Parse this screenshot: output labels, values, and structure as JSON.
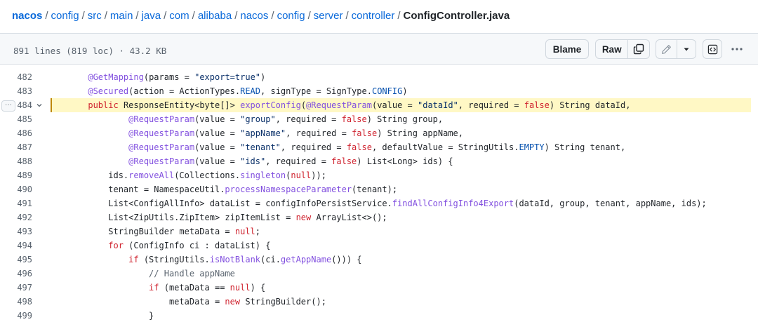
{
  "breadcrumb": {
    "parts": [
      "nacos",
      "config",
      "src",
      "main",
      "java",
      "com",
      "alibaba",
      "nacos",
      "config",
      "server",
      "controller"
    ],
    "separator": "/",
    "file": "ConfigController.java"
  },
  "toolbar": {
    "file_info": "891 lines (819 loc) · 43.2 KB",
    "blame_label": "Blame",
    "raw_label": "Raw",
    "more_label": "···"
  },
  "colors": {
    "link": "#0969da",
    "keyword": "#cf222e",
    "function": "#8250df",
    "string": "#0a3069",
    "constant": "#0550ae",
    "comment": "#59636e",
    "highlight_bg": "#fff8c5",
    "highlight_bar": "#bf8700"
  },
  "icons": {
    "copy": "copy-icon",
    "edit": "pencil-icon",
    "dropdown": "triangle-down-icon",
    "symbols": "code-square-icon",
    "more": "kebab-horizontal-icon",
    "fold": "chevron-down-icon"
  },
  "code": {
    "highlighted_line": 484,
    "lines": [
      {
        "num": "482",
        "tokens": [
          [
            "      ",
            "p"
          ],
          [
            "@GetMapping",
            "f"
          ],
          [
            "(params = ",
            "p"
          ],
          [
            "\"export=true\"",
            "s"
          ],
          [
            ")",
            "p"
          ]
        ]
      },
      {
        "num": "483",
        "tokens": [
          [
            "      ",
            "p"
          ],
          [
            "@Secured",
            "f"
          ],
          [
            "(action = ActionTypes.",
            "p"
          ],
          [
            "READ",
            "c"
          ],
          [
            ", signType = SignType.",
            "p"
          ],
          [
            "CONFIG",
            "c"
          ],
          [
            ")",
            "p"
          ]
        ]
      },
      {
        "num": "484",
        "tokens": [
          [
            "      ",
            "p"
          ],
          [
            "public",
            "k"
          ],
          [
            " ResponseEntity<byte[]> ",
            "p"
          ],
          [
            "exportConfig",
            "f"
          ],
          [
            "(",
            "p"
          ],
          [
            "@RequestParam",
            "f"
          ],
          [
            "(value = ",
            "p"
          ],
          [
            "\"dataId\"",
            "s"
          ],
          [
            ", required = ",
            "p"
          ],
          [
            "false",
            "k"
          ],
          [
            ") String dataId,",
            "p"
          ]
        ]
      },
      {
        "num": "485",
        "tokens": [
          [
            "              ",
            "p"
          ],
          [
            "@RequestParam",
            "f"
          ],
          [
            "(value = ",
            "p"
          ],
          [
            "\"group\"",
            "s"
          ],
          [
            ", required = ",
            "p"
          ],
          [
            "false",
            "k"
          ],
          [
            ") String group,",
            "p"
          ]
        ]
      },
      {
        "num": "486",
        "tokens": [
          [
            "              ",
            "p"
          ],
          [
            "@RequestParam",
            "f"
          ],
          [
            "(value = ",
            "p"
          ],
          [
            "\"appName\"",
            "s"
          ],
          [
            ", required = ",
            "p"
          ],
          [
            "false",
            "k"
          ],
          [
            ") String appName,",
            "p"
          ]
        ]
      },
      {
        "num": "487",
        "tokens": [
          [
            "              ",
            "p"
          ],
          [
            "@RequestParam",
            "f"
          ],
          [
            "(value = ",
            "p"
          ],
          [
            "\"tenant\"",
            "s"
          ],
          [
            ", required = ",
            "p"
          ],
          [
            "false",
            "k"
          ],
          [
            ", defaultValue = StringUtils.",
            "p"
          ],
          [
            "EMPTY",
            "c"
          ],
          [
            ") String tenant,",
            "p"
          ]
        ]
      },
      {
        "num": "488",
        "tokens": [
          [
            "              ",
            "p"
          ],
          [
            "@RequestParam",
            "f"
          ],
          [
            "(value = ",
            "p"
          ],
          [
            "\"ids\"",
            "s"
          ],
          [
            ", required = ",
            "p"
          ],
          [
            "false",
            "k"
          ],
          [
            ") List<Long> ids) {",
            "p"
          ]
        ]
      },
      {
        "num": "489",
        "tokens": [
          [
            "          ids.",
            "p"
          ],
          [
            "removeAll",
            "f"
          ],
          [
            "(Collections.",
            "p"
          ],
          [
            "singleton",
            "f"
          ],
          [
            "(",
            "p"
          ],
          [
            "null",
            "k"
          ],
          [
            "));",
            "p"
          ]
        ]
      },
      {
        "num": "490",
        "tokens": [
          [
            "          tenant = NamespaceUtil.",
            "p"
          ],
          [
            "processNamespaceParameter",
            "f"
          ],
          [
            "(tenant);",
            "p"
          ]
        ]
      },
      {
        "num": "491",
        "tokens": [
          [
            "          List<ConfigAllInfo> dataList = configInfoPersistService.",
            "p"
          ],
          [
            "findAllConfigInfo4Export",
            "f"
          ],
          [
            "(dataId, group, tenant, appName, ids);",
            "p"
          ]
        ]
      },
      {
        "num": "492",
        "tokens": [
          [
            "          List<ZipUtils.ZipItem> zipItemList = ",
            "p"
          ],
          [
            "new",
            "k"
          ],
          [
            " ArrayList<>();",
            "p"
          ]
        ]
      },
      {
        "num": "493",
        "tokens": [
          [
            "          StringBuilder metaData = ",
            "p"
          ],
          [
            "null",
            "k"
          ],
          [
            ";",
            "p"
          ]
        ]
      },
      {
        "num": "494",
        "tokens": [
          [
            "          ",
            "p"
          ],
          [
            "for",
            "k"
          ],
          [
            " (ConfigInfo ci : dataList) {",
            "p"
          ]
        ]
      },
      {
        "num": "495",
        "tokens": [
          [
            "              ",
            "p"
          ],
          [
            "if",
            "k"
          ],
          [
            " (StringUtils.",
            "p"
          ],
          [
            "isNotBlank",
            "f"
          ],
          [
            "(ci.",
            "p"
          ],
          [
            "getAppName",
            "f"
          ],
          [
            "())) {",
            "p"
          ]
        ]
      },
      {
        "num": "496",
        "tokens": [
          [
            "                  ",
            "p"
          ],
          [
            "// Handle appName",
            "m"
          ]
        ]
      },
      {
        "num": "497",
        "tokens": [
          [
            "                  ",
            "p"
          ],
          [
            "if",
            "k"
          ],
          [
            " (metaData == ",
            "p"
          ],
          [
            "null",
            "k"
          ],
          [
            ") {",
            "p"
          ]
        ]
      },
      {
        "num": "498",
        "tokens": [
          [
            "                      metaData = ",
            "p"
          ],
          [
            "new",
            "k"
          ],
          [
            " StringBuilder();",
            "p"
          ]
        ]
      },
      {
        "num": "499",
        "tokens": [
          [
            "                  }",
            "p"
          ]
        ]
      }
    ]
  }
}
